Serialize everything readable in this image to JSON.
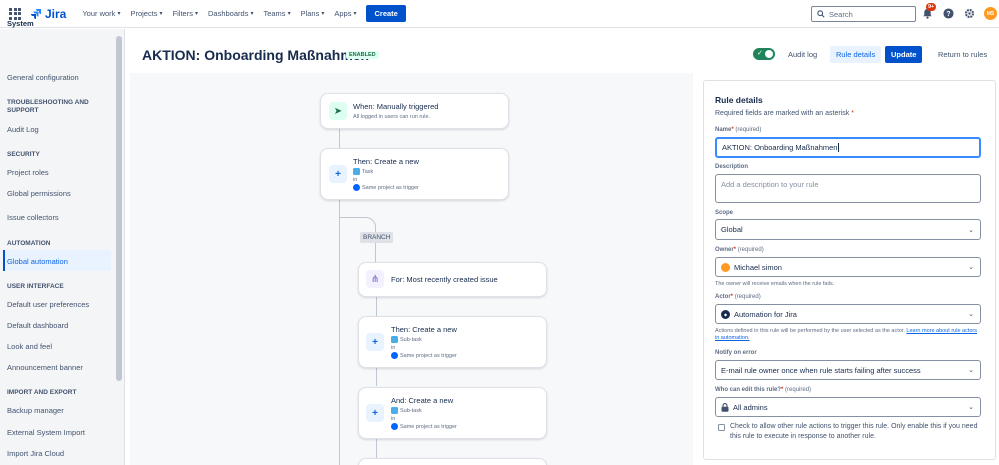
{
  "nav": {
    "logo": "Jira",
    "menu": [
      "Your work",
      "Projects",
      "Filters",
      "Dashboards",
      "Teams",
      "Plans",
      "Apps"
    ],
    "create": "Create",
    "search_placeholder": "Search",
    "notifications_badge": "9+",
    "avatar_initials": "MS"
  },
  "sidebar": {
    "title": "System",
    "items": {
      "general_configuration": "General configuration",
      "troubleshooting_head": "TROUBLESHOOTING AND SUPPORT",
      "audit_log": "Audit Log",
      "security_head": "SECURITY",
      "project_roles": "Project roles",
      "global_permissions": "Global permissions",
      "issue_collectors": "Issue collectors",
      "automation_head": "AUTOMATION",
      "global_automation": "Global automation",
      "ui_head": "USER INTERFACE",
      "default_user_preferences": "Default user preferences",
      "default_dashboard": "Default dashboard",
      "look_and_feel": "Look and feel",
      "announcement_banner": "Announcement banner",
      "import_export_head": "IMPORT AND EXPORT",
      "backup_manager": "Backup manager",
      "external_system_import": "External System Import",
      "import_jira_cloud": "Import Jira Cloud"
    }
  },
  "header": {
    "rule_title": "AKTION: Onboarding Maßnahmen",
    "status": "ENABLED",
    "audit_log": "Audit log",
    "rule_details": "Rule details",
    "update": "Update",
    "return": "Return to rules"
  },
  "flow": {
    "trigger": {
      "title": "When: Manually triggered",
      "sub": "All logged in users can run rule."
    },
    "action1": {
      "title": "Then: Create a new",
      "type": "Task",
      "in": "in",
      "project": "Same project as trigger"
    },
    "branch_label": "BRANCH",
    "branch": {
      "title": "For: Most recently created issue"
    },
    "action2": {
      "title": "Then: Create a new",
      "type": "Sub-task",
      "in": "in",
      "project": "Same project as trigger"
    },
    "action3": {
      "title": "And: Create a new",
      "type": "Sub-task",
      "in": "in",
      "project": "Same project as trigger"
    }
  },
  "panel": {
    "title": "Rule details",
    "required_note": "Required fields are marked with an asterisk",
    "name_label": "Name",
    "name_hint": "(required)",
    "name_value": "AKTION: Onboarding Maßnahmen",
    "description_label": "Description",
    "description_placeholder": "Add a description to your rule",
    "scope_label": "Scope",
    "scope_value": "Global",
    "owner_label": "Owner",
    "owner_hint": "(required)",
    "owner_value": "Michael simon",
    "owner_help": "The owner will receive emails when the rule fails.",
    "actor_label": "Actor",
    "actor_hint": "(required)",
    "actor_value": "Automation for Jira",
    "actor_help": "Actions defined in this rule will be performed by the user selected as the actor.",
    "actor_link": "Learn more about rule actors in automation.",
    "notify_label": "Notify on error",
    "notify_value": "E-mail rule owner once when rule starts failing after success",
    "edit_label": "Who can edit this rule?",
    "edit_hint": "(required)",
    "edit_value": "All admins",
    "checkbox_text": "Check to allow other rule actions to trigger this rule. Only enable this if you need this rule to execute in response to another rule."
  }
}
